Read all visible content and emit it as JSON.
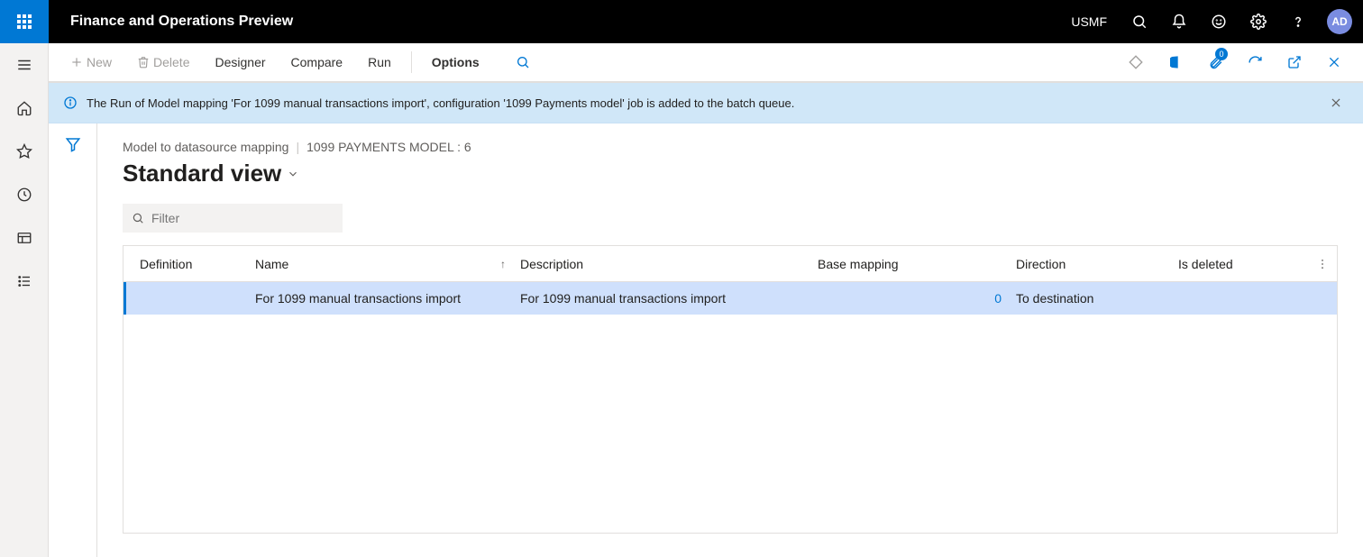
{
  "header": {
    "app_title": "Finance and Operations Preview",
    "company": "USMF",
    "avatar_initials": "AD"
  },
  "action_bar": {
    "new": "New",
    "delete": "Delete",
    "designer": "Designer",
    "compare": "Compare",
    "run": "Run",
    "options": "Options",
    "attachments_badge": "0"
  },
  "banner": {
    "message": "The Run of Model mapping 'For 1099 manual transactions import', configuration '1099 Payments model' job is added to the batch queue."
  },
  "breadcrumb": {
    "a": "Model to datasource mapping",
    "b": "1099 PAYMENTS MODEL : 6"
  },
  "page": {
    "title": "Standard view",
    "filter_placeholder": "Filter"
  },
  "columns": {
    "definition": "Definition",
    "name": "Name",
    "description": "Description",
    "base_mapping": "Base mapping",
    "direction": "Direction",
    "is_deleted": "Is deleted"
  },
  "rows": [
    {
      "definition": "",
      "name": "For 1099 manual transactions import",
      "description": "For 1099 manual transactions import",
      "base_num": "0",
      "direction": "To destination",
      "is_deleted": ""
    }
  ]
}
